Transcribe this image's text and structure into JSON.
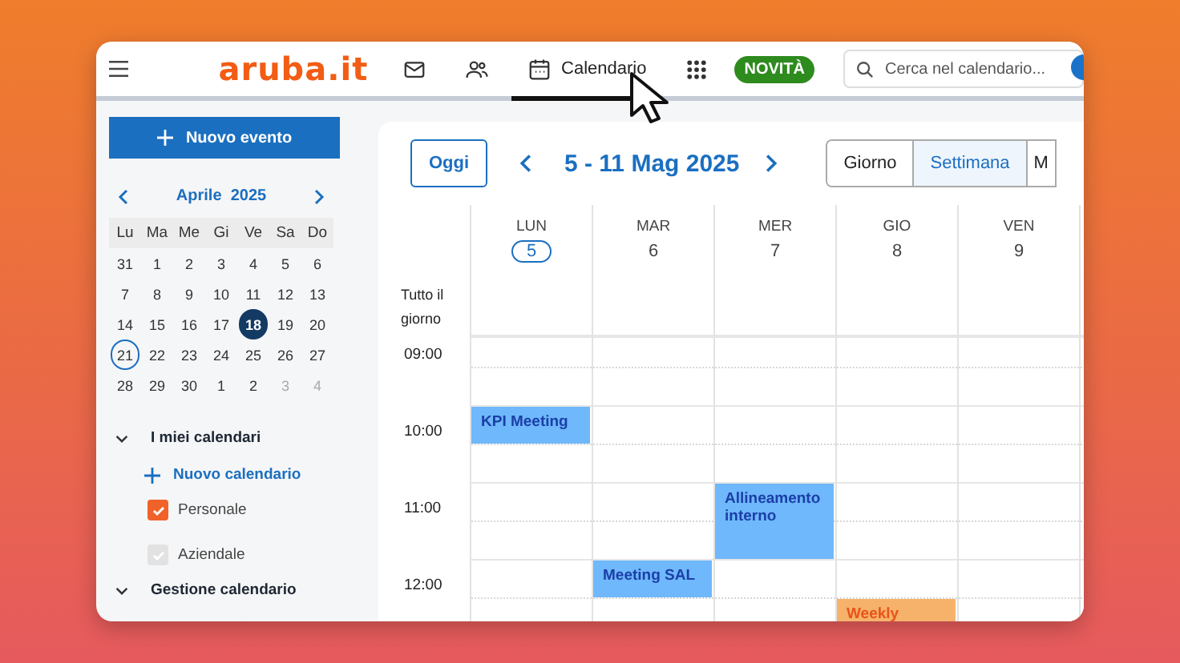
{
  "header": {
    "logo": "aruba.it",
    "nav": [
      {
        "kind": "mail",
        "selected": false
      },
      {
        "kind": "people",
        "selected": false
      },
      {
        "kind": "calendar",
        "label": "Calendario",
        "selected": true
      },
      {
        "kind": "apps",
        "selected": false
      }
    ],
    "badge": "NOVITÀ",
    "search": {
      "placeholder": "Cerca nel calendario..."
    }
  },
  "sidebar": {
    "new_event": "Nuovo evento",
    "mini_calendar": {
      "title": "Aprile  2025",
      "weekdays": [
        "Lu",
        "Ma",
        "Me",
        "Gi",
        "Ve",
        "Sa",
        "Do"
      ],
      "weeks": [
        [
          {
            "day": "31",
            "selected": false,
            "today": false,
            "muted": false
          },
          {
            "day": "1",
            "selected": false,
            "today": false,
            "muted": false
          },
          {
            "day": "2",
            "selected": false,
            "today": false,
            "muted": false
          },
          {
            "day": "3",
            "selected": false,
            "today": false,
            "muted": false
          },
          {
            "day": "4",
            "selected": false,
            "today": false,
            "muted": false
          },
          {
            "day": "5",
            "selected": false,
            "today": false,
            "muted": false
          },
          {
            "day": "6",
            "selected": false,
            "today": false,
            "muted": false
          }
        ],
        [
          {
            "day": "7",
            "selected": false,
            "today": false,
            "muted": false
          },
          {
            "day": "8",
            "selected": false,
            "today": false,
            "muted": false
          },
          {
            "day": "9",
            "selected": false,
            "today": false,
            "muted": false
          },
          {
            "day": "10",
            "selected": false,
            "today": false,
            "muted": false
          },
          {
            "day": "11",
            "selected": false,
            "today": false,
            "muted": false
          },
          {
            "day": "12",
            "selected": false,
            "today": false,
            "muted": false
          },
          {
            "day": "13",
            "selected": false,
            "today": false,
            "muted": false
          }
        ],
        [
          {
            "day": "14",
            "selected": false,
            "today": false,
            "muted": false
          },
          {
            "day": "15",
            "selected": false,
            "today": false,
            "muted": false
          },
          {
            "day": "16",
            "selected": false,
            "today": false,
            "muted": false
          },
          {
            "day": "17",
            "selected": false,
            "today": false,
            "muted": false
          },
          {
            "day": "18",
            "selected": true,
            "today": false,
            "muted": false
          },
          {
            "day": "19",
            "selected": false,
            "today": false,
            "muted": false
          },
          {
            "day": "20",
            "selected": false,
            "today": false,
            "muted": false
          }
        ],
        [
          {
            "day": "21",
            "selected": false,
            "today": true,
            "muted": false
          },
          {
            "day": "22",
            "selected": false,
            "today": false,
            "muted": false
          },
          {
            "day": "23",
            "selected": false,
            "today": false,
            "muted": false
          },
          {
            "day": "24",
            "selected": false,
            "today": false,
            "muted": false
          },
          {
            "day": "25",
            "selected": false,
            "today": false,
            "muted": false
          },
          {
            "day": "26",
            "selected": false,
            "today": false,
            "muted": false
          },
          {
            "day": "27",
            "selected": false,
            "today": false,
            "muted": false
          }
        ],
        [
          {
            "day": "28",
            "selected": false,
            "today": false,
            "muted": false
          },
          {
            "day": "29",
            "selected": false,
            "today": false,
            "muted": false
          },
          {
            "day": "30",
            "selected": false,
            "today": false,
            "muted": false
          },
          {
            "day": "1",
            "selected": false,
            "today": false,
            "muted": false
          },
          {
            "day": "2",
            "selected": false,
            "today": false,
            "muted": false
          },
          {
            "day": "3",
            "selected": false,
            "today": false,
            "muted": true
          },
          {
            "day": "4",
            "selected": false,
            "today": false,
            "muted": true
          }
        ]
      ]
    },
    "sections": [
      {
        "title": "I miei calendari",
        "expanded": true,
        "add_label": "Nuovo calendario",
        "calendars": [
          {
            "name": "Personale",
            "checked": true,
            "disabled": false
          },
          {
            "name": "Aziendale",
            "checked": true,
            "disabled": true
          }
        ]
      },
      {
        "title": "Gestione calendario",
        "expanded": true
      }
    ]
  },
  "toolbar": {
    "today_button": "Oggi",
    "range_title": "5 - 11 Mag 2025",
    "views": [
      {
        "label": "Giorno",
        "selected": false
      },
      {
        "label": "Settimana",
        "selected": true
      },
      {
        "label": "M",
        "selected": false
      }
    ]
  },
  "week": {
    "days": [
      {
        "name": "LUN",
        "number": "5",
        "today": true,
        "events": [
          {
            "title": "KPI Meeting",
            "kind": "work"
          }
        ]
      },
      {
        "name": "MAR",
        "number": "6",
        "today": false,
        "events": [
          {
            "title": "Meeting SAL",
            "kind": "work"
          }
        ]
      },
      {
        "name": "MER",
        "number": "7",
        "today": false,
        "events": [
          {
            "title": "Allineamento interno",
            "kind": "work"
          }
        ]
      },
      {
        "name": "GIO",
        "number": "8",
        "today": false,
        "events": [
          {
            "title": "Weekly",
            "kind": "personal"
          }
        ]
      },
      {
        "name": "VEN",
        "number": "9",
        "today": false
      }
    ],
    "all_day_label": "Tutto il giorno",
    "hours": [
      "09:00",
      "10:00",
      "11:00",
      "12:00"
    ]
  }
}
